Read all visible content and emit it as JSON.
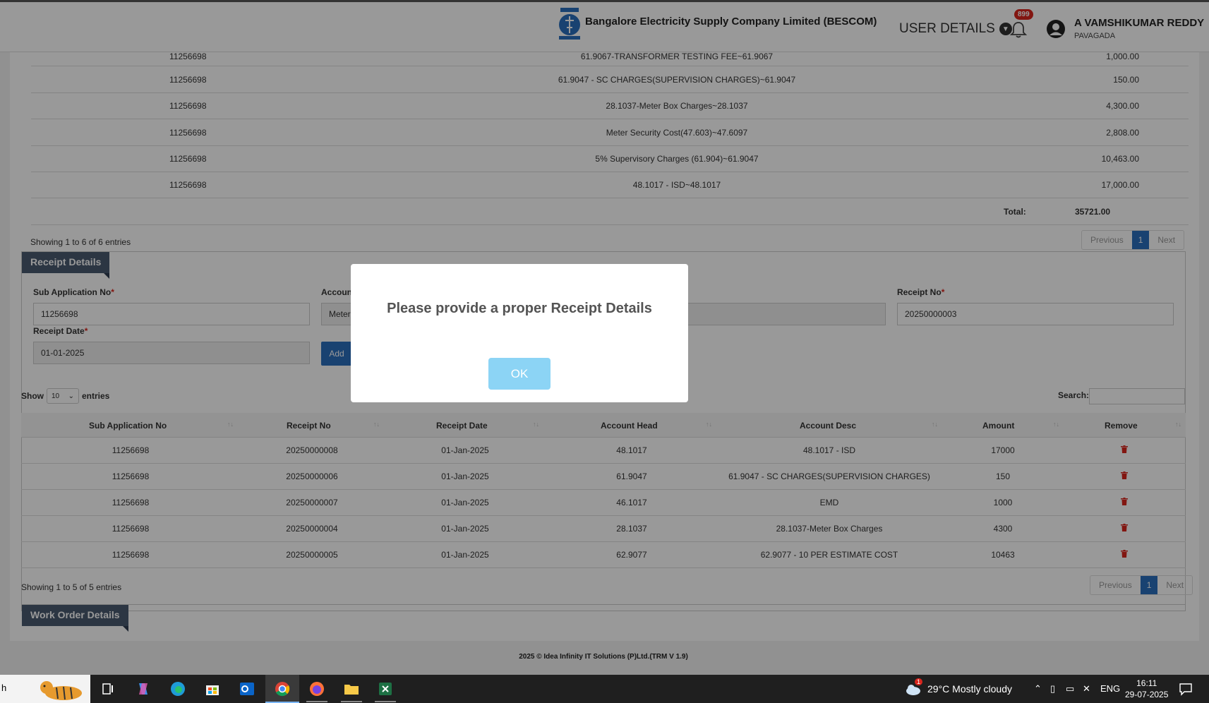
{
  "header": {
    "company": "Bangalore Electricity Supply Company Limited (BESCOM)",
    "user_details_label": "USER DETAILS",
    "notification_count": "899",
    "user_name": "A VAMSHIKUMAR REDDY",
    "user_location": "PAVAGADA"
  },
  "charges": {
    "rows": [
      {
        "id": "11256698",
        "desc": "61.9067-TRANSFORMER TESTING FEE~61.9067",
        "amount": "1,000.00"
      },
      {
        "id": "11256698",
        "desc": "61.9047 - SC CHARGES(SUPERVISION CHARGES)~61.9047",
        "amount": "150.00"
      },
      {
        "id": "11256698",
        "desc": "28.1037-Meter Box Charges~28.1037",
        "amount": "4,300.00"
      },
      {
        "id": "11256698",
        "desc": "Meter Security Cost(47.603)~47.6097",
        "amount": "2,808.00"
      },
      {
        "id": "11256698",
        "desc": "5% Supervisory Charges (61.904)~61.9047",
        "amount": "10,463.00"
      },
      {
        "id": "11256698",
        "desc": "48.1017 - ISD~48.1017",
        "amount": "17,000.00"
      }
    ],
    "total_label": "Total:",
    "total_value": "35721.00",
    "info": "Showing 1 to 6 of 6 entries",
    "pager": {
      "prev": "Previous",
      "page": "1",
      "next": "Next"
    }
  },
  "receipt": {
    "section_title": "Receipt Details",
    "sub_app_label": "Sub Application No",
    "sub_app_value": "11256698",
    "account_label": "Account",
    "account_value": "Meter",
    "receipt_no_label": "Receipt No",
    "receipt_no_value": "20250000003",
    "receipt_date_label": "Receipt Date",
    "receipt_date_value": "01-01-2025",
    "add_label": "Add",
    "required_mark": "*"
  },
  "table": {
    "show_label": "Show",
    "entries_value": "10",
    "entries_label": "entries",
    "search_label": "Search:",
    "headers": [
      "Sub Application No",
      "Receipt No",
      "Receipt Date",
      "Account Head",
      "Account Desc",
      "Amount",
      "Remove"
    ],
    "rows": [
      {
        "sub": "11256698",
        "receipt": "20250000008",
        "date": "01-Jan-2025",
        "head": "48.1017",
        "desc": "48.1017 - ISD",
        "amount": "17000"
      },
      {
        "sub": "11256698",
        "receipt": "20250000006",
        "date": "01-Jan-2025",
        "head": "61.9047",
        "desc": "61.9047 - SC CHARGES(SUPERVISION CHARGES)",
        "amount": "150"
      },
      {
        "sub": "11256698",
        "receipt": "20250000007",
        "date": "01-Jan-2025",
        "head": "46.1017",
        "desc": "EMD",
        "amount": "1000"
      },
      {
        "sub": "11256698",
        "receipt": "20250000004",
        "date": "01-Jan-2025",
        "head": "28.1037",
        "desc": "28.1037-Meter Box Charges",
        "amount": "4300"
      },
      {
        "sub": "11256698",
        "receipt": "20250000005",
        "date": "01-Jan-2025",
        "head": "62.9077",
        "desc": "62.9077 - 10 PER ESTIMATE COST",
        "amount": "10463"
      }
    ],
    "info": "Showing 1 to 5 of 5 entries",
    "pager": {
      "prev": "Previous",
      "page": "1",
      "next": "Next"
    }
  },
  "work_order": {
    "section_title": "Work Order Details"
  },
  "footer": {
    "text": "2025 © Idea Infinity IT Solutions (P)Ltd.(TRM V 1.9)"
  },
  "modal": {
    "message": "Please provide a proper Receipt Details",
    "ok_label": "OK"
  },
  "taskbar": {
    "search_fragment": "h",
    "weather_badge": "1",
    "weather": "29°C  Mostly cloudy",
    "lang": "ENG",
    "time": "16:11",
    "date": "29-07-2025"
  },
  "colors": {
    "accent": "#2a6ebd",
    "section": "#4a5a70",
    "danger": "#d9251d",
    "ok_button": "#8cd4f5"
  }
}
